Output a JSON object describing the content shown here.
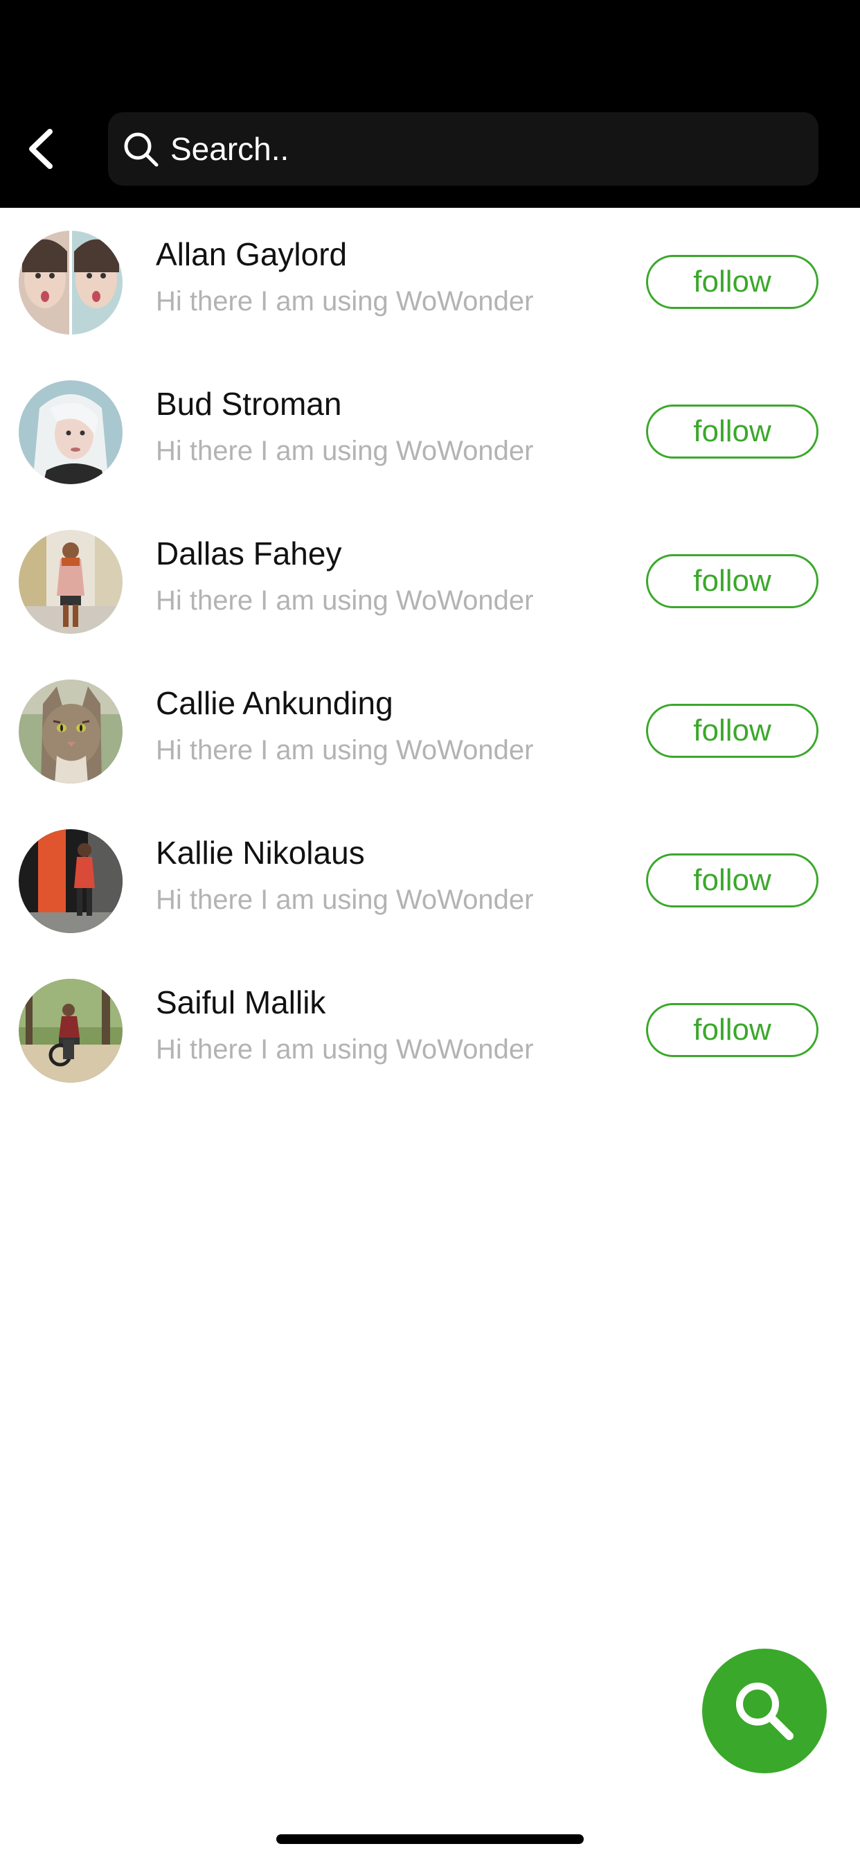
{
  "header": {
    "back_icon": "chevron-left-icon",
    "search": {
      "placeholder": "Search..",
      "value": "",
      "icon": "search-icon"
    }
  },
  "users": [
    {
      "name": "Allan Gaylord",
      "status": "Hi there I am using WoWonder",
      "follow_label": "follow"
    },
    {
      "name": "Bud Stroman",
      "status": "Hi there I am using WoWonder",
      "follow_label": "follow"
    },
    {
      "name": "Dallas Fahey",
      "status": "Hi there I am using WoWonder",
      "follow_label": "follow"
    },
    {
      "name": "Callie Ankunding",
      "status": "Hi there I am using WoWonder",
      "follow_label": "follow"
    },
    {
      "name": "Kallie Nikolaus",
      "status": "Hi there I am using WoWonder",
      "follow_label": "follow"
    },
    {
      "name": "Saiful Mallik",
      "status": "Hi there I am using WoWonder",
      "follow_label": "follow"
    }
  ],
  "fab": {
    "icon": "search-icon"
  },
  "colors": {
    "accent": "#3aa82a",
    "header_bg": "#000000",
    "search_bg": "#141414",
    "status_text": "#b3b3b3"
  }
}
